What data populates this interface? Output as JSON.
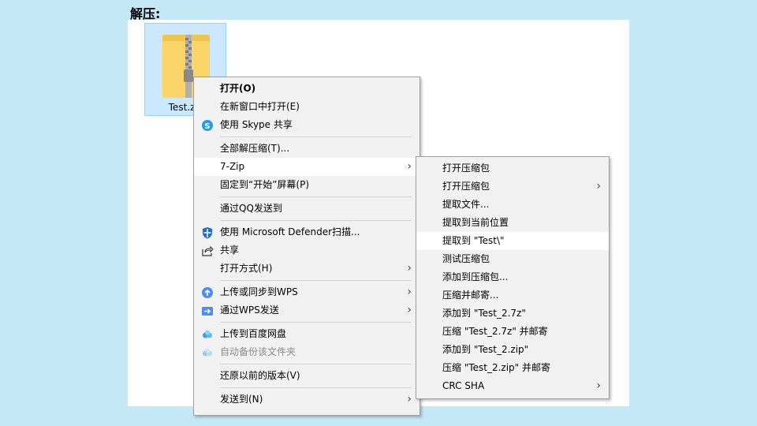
{
  "heading": "解压:",
  "file": {
    "name": "Test.zip"
  },
  "main_menu": {
    "items": [
      {
        "label": "打开(O)",
        "bold": true
      },
      {
        "label": "在新窗口中打开(E)"
      },
      {
        "label": "使用 Skype 共享",
        "icon": "skype-icon"
      },
      {
        "separator": true
      },
      {
        "label": "全部解压缩(T)..."
      },
      {
        "label": "7-Zip",
        "submenu": true,
        "highlight": true
      },
      {
        "label": "固定到“开始”屏幕(P)"
      },
      {
        "separator": true
      },
      {
        "label": "通过QQ发送到"
      },
      {
        "separator": true
      },
      {
        "label": "使用 Microsoft Defender扫描...",
        "icon": "defender-shield-icon"
      },
      {
        "label": "共享",
        "icon": "share-icon"
      },
      {
        "label": "打开方式(H)",
        "submenu": true
      },
      {
        "separator": true
      },
      {
        "label": "上传或同步到WPS",
        "icon": "wps-cloud-upload-icon",
        "submenu": true
      },
      {
        "label": "通过WPS发送",
        "icon": "wps-send-icon",
        "submenu": true
      },
      {
        "separator": true
      },
      {
        "label": "上传到百度网盘",
        "icon": "baidu-netdisk-icon"
      },
      {
        "label": "自动备份该文件夹",
        "icon": "baidu-backup-icon",
        "disabled": true
      },
      {
        "separator": true
      },
      {
        "label": "还原以前的版本(V)"
      },
      {
        "separator": true
      },
      {
        "label": "发送到(N)",
        "submenu": true
      }
    ]
  },
  "sub_menu": {
    "items": [
      {
        "label": "打开压缩包"
      },
      {
        "label": "打开压缩包",
        "submenu": true
      },
      {
        "label": "提取文件..."
      },
      {
        "label": "提取到当前位置"
      },
      {
        "label": "提取到 \"Test\\\"",
        "highlight": true
      },
      {
        "label": "测试压缩包"
      },
      {
        "label": "添加到压缩包..."
      },
      {
        "label": "压缩并邮寄..."
      },
      {
        "label": "添加到 \"Test_2.7z\""
      },
      {
        "label": "压缩 \"Test_2.7z\" 并邮寄"
      },
      {
        "label": "添加到 \"Test_2.zip\""
      },
      {
        "label": "压缩 \"Test_2.zip\" 并邮寄"
      },
      {
        "label": "CRC SHA",
        "submenu": true
      }
    ]
  },
  "colors": {
    "page_background": "#c5e8f7",
    "selection": "#cce8ff",
    "menu_background": "#f2f2f2",
    "skype": "#1e9fe8",
    "defender": "#1f6fc5",
    "wps": "#4a8ef0",
    "baidu": "#3aa0e8"
  }
}
